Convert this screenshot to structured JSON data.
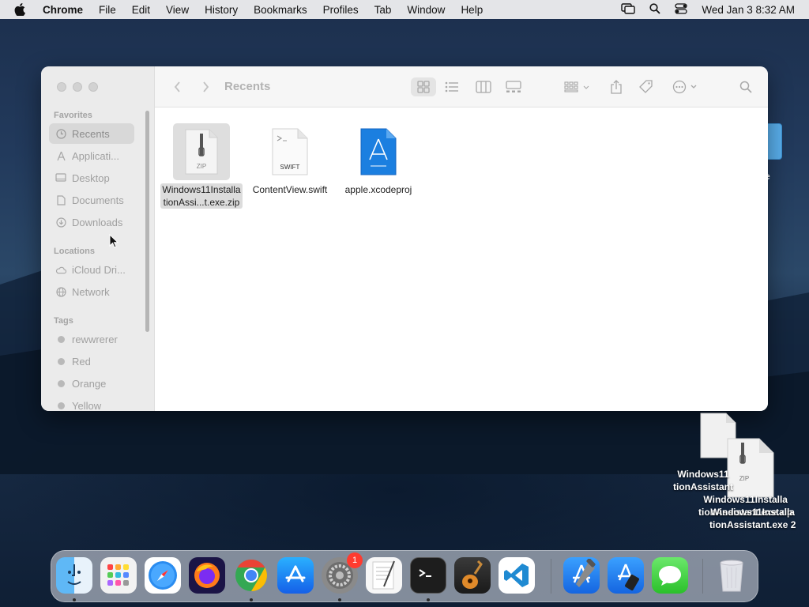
{
  "menubar": {
    "items": [
      "Chrome",
      "File",
      "Edit",
      "View",
      "History",
      "Bookmarks",
      "Profiles",
      "Tab",
      "Window",
      "Help"
    ],
    "datetime": "Wed Jan 3  8:32 AM",
    "icons": [
      "apple-icon",
      "screen-mirroring-icon",
      "spotlight-search-icon",
      "control-center-icon"
    ]
  },
  "finder": {
    "title": "Recents",
    "sidebar": {
      "favorites_header": "Favorites",
      "favorites": [
        "Recents",
        "Applicati...",
        "Desktop",
        "Documents",
        "Downloads"
      ],
      "locations_header": "Locations",
      "locations": [
        "iCloud Dri...",
        "Network"
      ],
      "tags_header": "Tags",
      "tags": [
        {
          "label": "rewwrerer",
          "color": "#b9b9b9"
        },
        {
          "label": "Red",
          "color": "#b9b9b9"
        },
        {
          "label": "Orange",
          "color": "#b9b9b9"
        },
        {
          "label": "Yellow",
          "color": "#b9b9b9"
        }
      ]
    },
    "files": [
      {
        "name": "Windows11InstallationAssi...t.exe.zip",
        "line1": "Windows11Installa",
        "line2": "tionAssi...t.exe.zip",
        "badge": "ZIP",
        "selected": true
      },
      {
        "name": "ContentView.swift",
        "line1": "ContentView.swift",
        "line2": "",
        "badge": "SWIFT",
        "selected": false
      },
      {
        "name": "apple.xcodeproj",
        "line1": "apple.xcodeproj",
        "line2": "",
        "badge": "",
        "selected": false
      }
    ]
  },
  "desktop": {
    "label_a_line1": "Windows11",
    "label_a_line2": "tionAssistant",
    "zip_badge": "ZIP",
    "label_b_line1": "Windows11Installa",
    "label_b_line2": "tionAssistant.exe.zip",
    "label_c_line1": "Windows11Installa",
    "label_c_line2": "tionAssistant.exe 2",
    "partial_label": "e"
  },
  "dock": {
    "apps": [
      "Finder",
      "Launchpad",
      "Safari",
      "Firefox",
      "Google Chrome",
      "App Store",
      "System Settings",
      "TextEdit",
      "Terminal",
      "GarageBand",
      "Visual Studio Code",
      "Xcode",
      "Simulator",
      "Messages",
      "Trash"
    ],
    "system_settings_badge": "1"
  }
}
